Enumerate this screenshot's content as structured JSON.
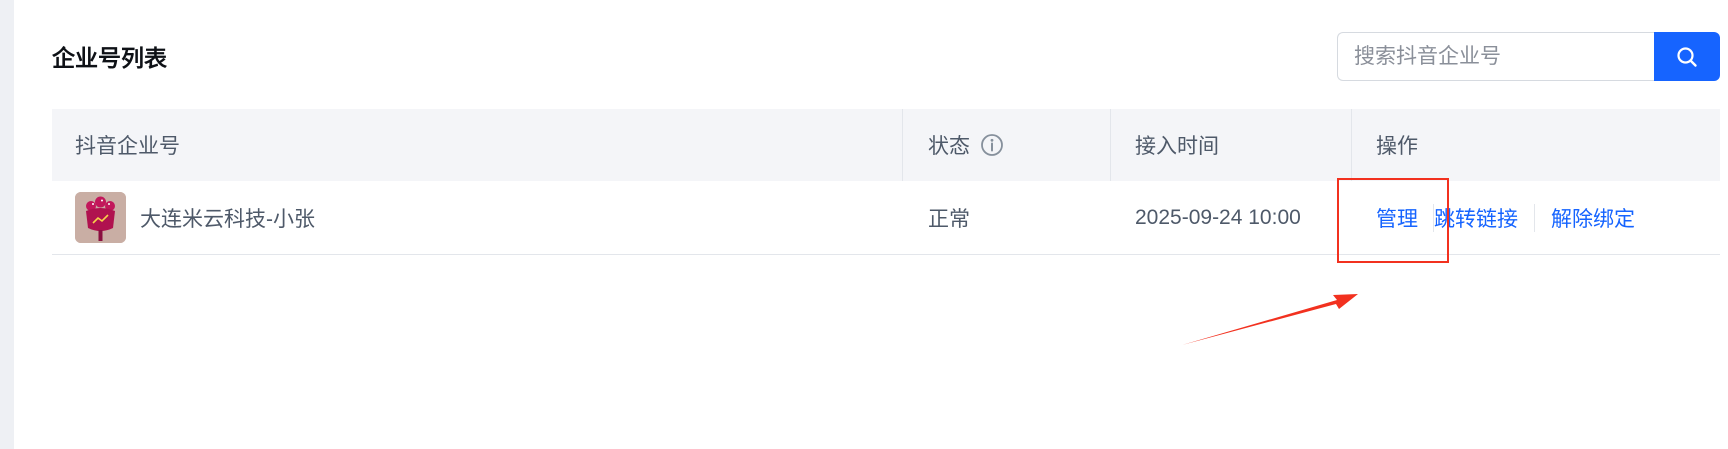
{
  "page": {
    "title": "企业号列表"
  },
  "search": {
    "placeholder": "搜索抖音企业号"
  },
  "table": {
    "columns": {
      "account": "抖音企业号",
      "status": "状态",
      "access_time": "接入时间",
      "actions": "操作"
    },
    "rows": [
      {
        "name": "大连米云科技-小张",
        "status": "正常",
        "access_time": "2025-09-24 10:00",
        "actions": {
          "manage": "管理",
          "jump": "跳转链接",
          "unbind": "解除绑定"
        }
      }
    ]
  },
  "colors": {
    "accent": "#1664ff",
    "annotation": "#f2311f"
  },
  "icons": {
    "search": "search-icon",
    "status_info": "info-circle-icon",
    "avatar": "flower-avatar-image",
    "annotation_arrow": "arrow-annotation"
  }
}
